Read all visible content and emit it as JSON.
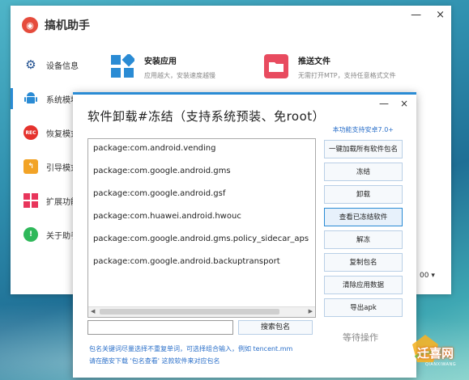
{
  "app": {
    "title": "搞机助手",
    "window_buttons": [
      "—",
      "×"
    ]
  },
  "top_features": [
    {
      "title": "安装应用",
      "desc": "应用越大，安装速度越慢"
    },
    {
      "title": "推送文件",
      "desc": "无需打开MTP，支持任意格式文件"
    }
  ],
  "sidebar": {
    "items": [
      {
        "label": "设备信息",
        "icon": "gear-icon"
      },
      {
        "label": "系统模块",
        "icon": "android-icon"
      },
      {
        "label": "恢复模式",
        "icon": "rec-icon",
        "badge": "REC"
      },
      {
        "label": "引导模式",
        "icon": "back-arrow-icon"
      },
      {
        "label": "扩展功能",
        "icon": "grid-icon"
      },
      {
        "label": "关于助手",
        "icon": "info-icon"
      }
    ]
  },
  "main_select_stub": "00 ▾",
  "dialog": {
    "title": "软件卸载#冻结（支持系统预装、免root）",
    "window_buttons": [
      "—",
      "×"
    ],
    "support_note": "本功能支持安卓7.0+",
    "packages": [
      "package:com.android.vending",
      "package:com.google.android.gms",
      "package:com.google.android.gsf",
      "package:com.huawei.android.hwouc",
      "package:com.google.android.gms.policy_sidecar_aps",
      "package:com.google.android.backuptransport"
    ],
    "actions": [
      "一键加载所有软件包名",
      "冻结",
      "卸载",
      "查看已冻结软件",
      "解冻",
      "复制包名",
      "清除应用数据",
      "导出apk"
    ],
    "search_value": "",
    "search_button": "搜索包名",
    "status": "等待操作",
    "tips": [
      "包名关键词尽量选择不重复单词，可选择组合输入，例如 tencent.mm",
      "请在酷安下载 '包名查看' 这款软件来对应包名"
    ]
  },
  "watermark": {
    "text": "迁喜网",
    "sub": "QIANXIWANG"
  },
  "colors": {
    "accent": "#2a8bd4",
    "tip_blue": "#2a6fc9",
    "logo_red": "#e54b3c"
  }
}
